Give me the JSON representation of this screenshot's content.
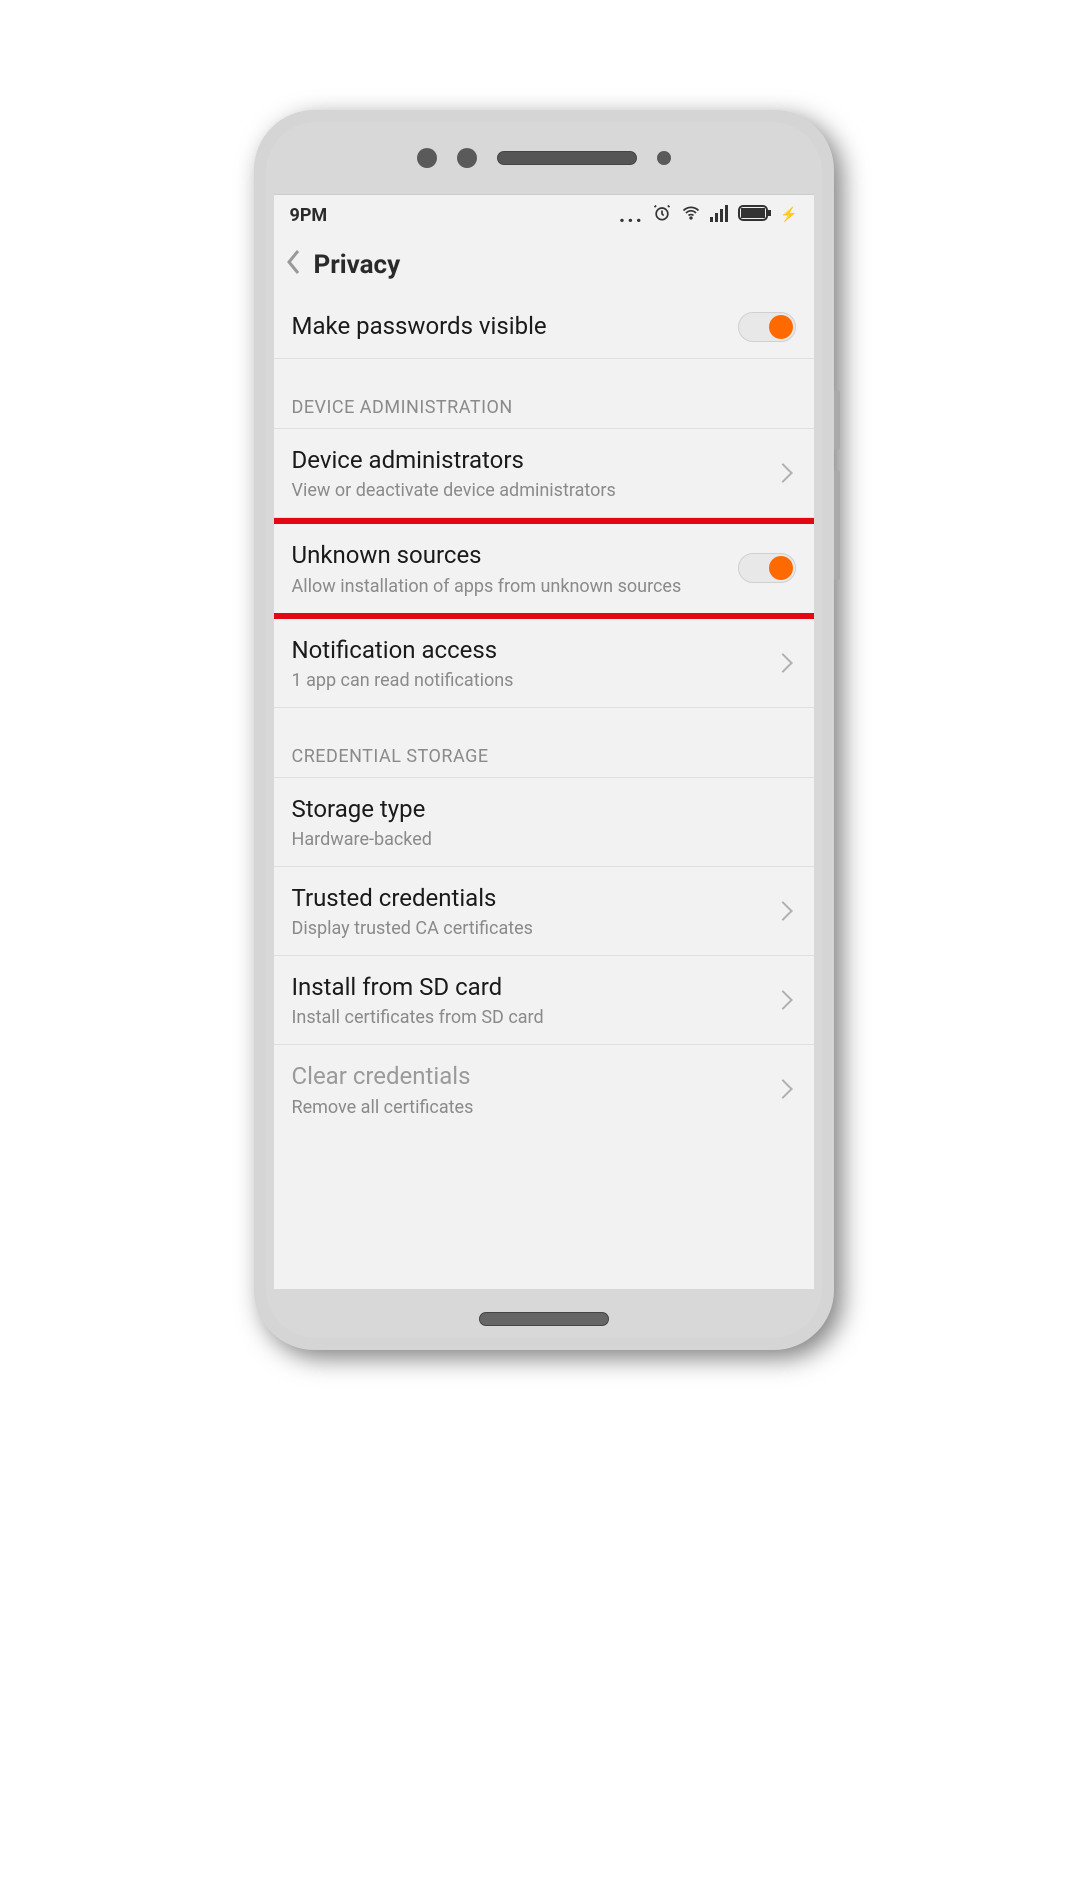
{
  "status": {
    "time": "9PM"
  },
  "header": {
    "title": "Privacy"
  },
  "rows": {
    "makePasswordsVisible": {
      "title": "Make passwords visible"
    },
    "section_device_admin": "DEVICE ADMINISTRATION",
    "deviceAdministrators": {
      "title": "Device administrators",
      "subtitle": "View or deactivate device administrators"
    },
    "unknownSources": {
      "title": "Unknown sources",
      "subtitle": "Allow installation of apps from unknown sources"
    },
    "notificationAccess": {
      "title": "Notification access",
      "subtitle": "1 app can read notifications"
    },
    "section_credential_storage": "CREDENTIAL STORAGE",
    "storageType": {
      "title": "Storage type",
      "subtitle": "Hardware-backed"
    },
    "trustedCredentials": {
      "title": "Trusted credentials",
      "subtitle": "Display trusted CA certificates"
    },
    "installFromSd": {
      "title": "Install from SD card",
      "subtitle": "Install certificates from SD card"
    },
    "clearCredentials": {
      "title": "Clear credentials",
      "subtitle": "Remove all certificates"
    }
  }
}
